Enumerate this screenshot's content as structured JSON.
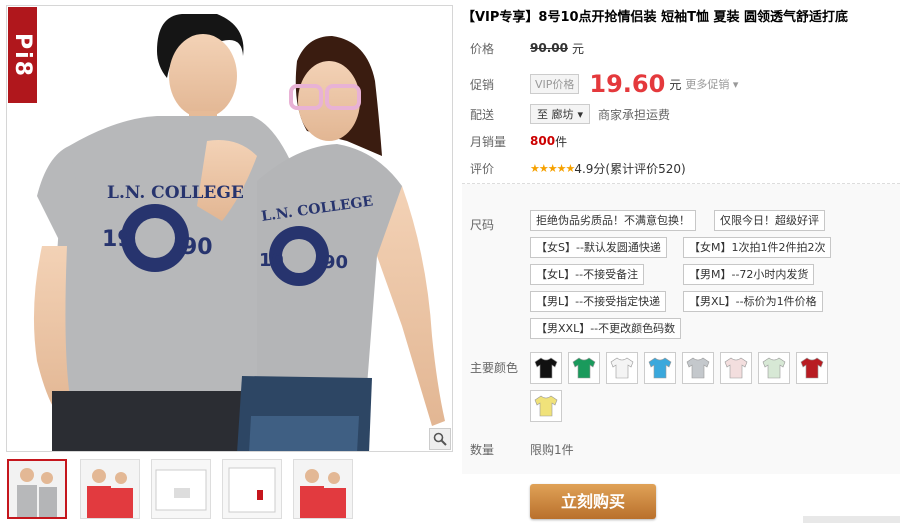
{
  "brand_mark": "Pi8",
  "title": "【VIP专享】8号10点开抢情侣装 短袖T恤 夏装 圆领透气舒适打底",
  "price": {
    "label": "价格",
    "original": "90.00",
    "unit": "元"
  },
  "promo": {
    "label": "促销",
    "vip_tag": "VIP价格",
    "price": "19.60",
    "unit": "元",
    "more": "更多促销"
  },
  "delivery": {
    "label": "配送",
    "dest": "至 廊坊",
    "note": "商家承担运费"
  },
  "monthly": {
    "label": "月销量",
    "count": "800",
    "unit": "件"
  },
  "rating": {
    "label": "评价",
    "stars": "★★★★★",
    "text": "4.9分(累计评价520)"
  },
  "sizes": {
    "label": "尺码",
    "options": [
      "拒绝伪品劣质品！不满意包换！",
      "仅限今日！超级好评",
      "【女S】--默认发圆通快递",
      "【女M】1次拍1件2件拍2次",
      "【女L】--不接受备注",
      "【男M】--72小时内发货",
      "【男L】--不接受指定快递",
      "【男XL】--标价为1件价格",
      "【男XXL】--不更改颜色码数"
    ]
  },
  "colors": {
    "label": "主要颜色",
    "swatches": [
      {
        "name": "black",
        "hex": "#111111"
      },
      {
        "name": "green",
        "hex": "#1a9a5c"
      },
      {
        "name": "white",
        "hex": "#f4f4f4"
      },
      {
        "name": "sky-blue",
        "hex": "#3aa8dc"
      },
      {
        "name": "gray",
        "hex": "#c4c8cc"
      },
      {
        "name": "pink-white",
        "hex": "#f3dede"
      },
      {
        "name": "light-green",
        "hex": "#d7e8d5"
      },
      {
        "name": "red",
        "hex": "#b81c22"
      },
      {
        "name": "yellow",
        "hex": "#f0e27a"
      }
    ]
  },
  "quantity": {
    "label": "数量",
    "limit": "限购1件"
  },
  "buy_label": "立刻购买",
  "shirt_text": {
    "line1": "L.N. COLLEGE",
    "left": "19",
    "right": "90"
  }
}
